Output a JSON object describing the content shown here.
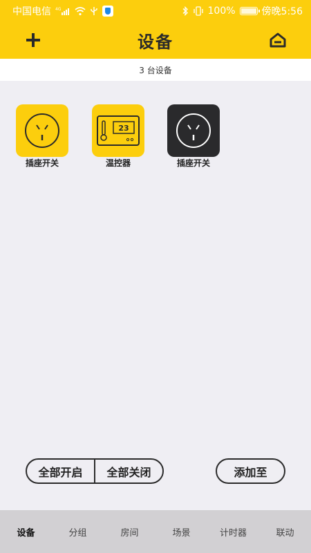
{
  "status_bar": {
    "carrier": "中国电信",
    "signal": "4G",
    "battery": "100%",
    "time": "傍晚5:56"
  },
  "header": {
    "title": "设备",
    "add_icon": "plus-icon",
    "home_icon": "home-icon"
  },
  "count_text": "3 台设备",
  "devices": [
    {
      "label": "插座开关",
      "icon": "socket-icon",
      "tile_color": "#fcce0d"
    },
    {
      "label": "温控器",
      "icon": "thermostat-icon",
      "tile_color": "#fcce0d",
      "display_value": "23"
    },
    {
      "label": "插座开关",
      "icon": "socket-icon",
      "tile_color": "#2a2a2c"
    }
  ],
  "actions": {
    "all_on": "全部开启",
    "all_off": "全部关闭",
    "add_to": "添加至"
  },
  "tabs": [
    {
      "label": "设备",
      "active": true
    },
    {
      "label": "分组"
    },
    {
      "label": "房间"
    },
    {
      "label": "场景"
    },
    {
      "label": "计时器"
    },
    {
      "label": "联动"
    }
  ],
  "colors": {
    "accent": "#fcce0d",
    "background": "#efeef3",
    "tabbar": "#d2d0d3",
    "dark_tile": "#2a2a2c"
  }
}
